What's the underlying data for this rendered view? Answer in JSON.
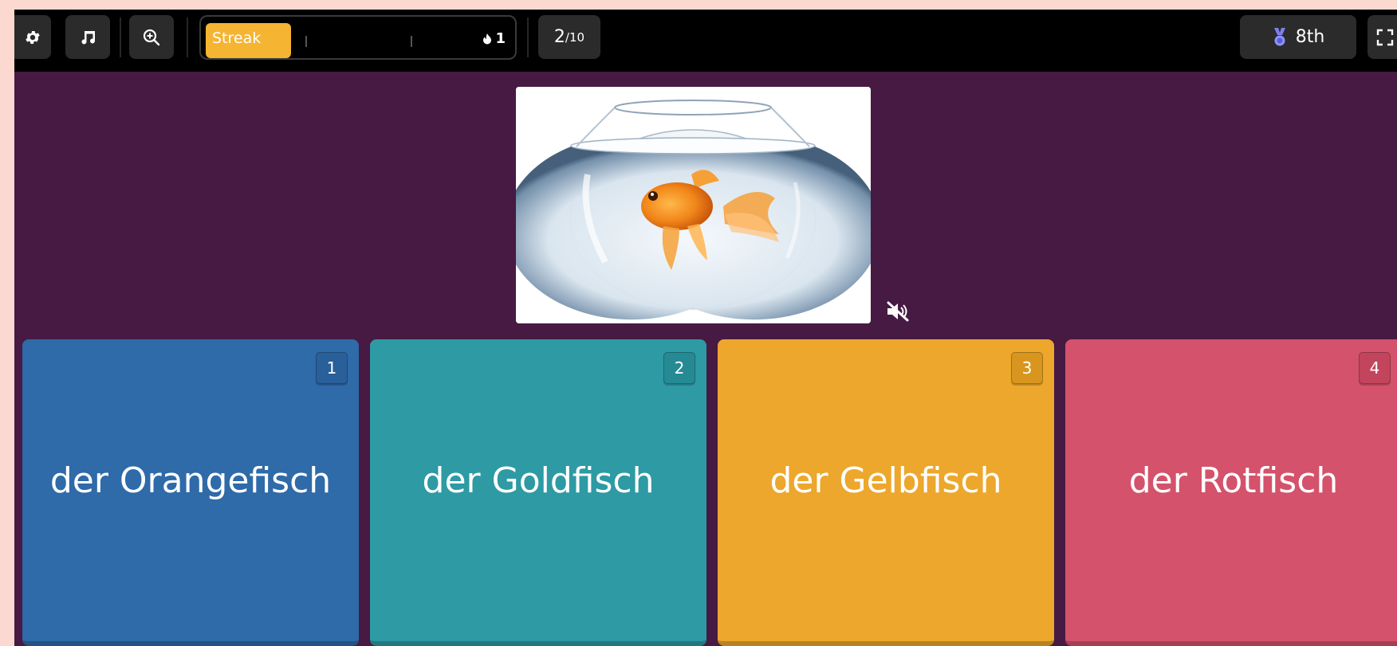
{
  "toolbar": {
    "settings_icon": "gear-icon",
    "music_icon": "music-note-icon",
    "zoom_icon": "zoom-in-icon",
    "streak_label": "Streak",
    "streak_count": "1",
    "streak_fill_fraction": 0.28,
    "progress_current": "2",
    "progress_total": "/10",
    "rank": "8th",
    "rank_icon": "medal-icon",
    "fullscreen_icon": "fullscreen-icon"
  },
  "question": {
    "image": "goldfish-in-bowl",
    "mute_icon": "volume-mute-icon"
  },
  "options": [
    {
      "number": "1",
      "text": "der Orangefisch",
      "color": "#2f6aa9",
      "badge": "#29609a"
    },
    {
      "number": "2",
      "text": "der Goldfisch",
      "color": "#2d9aa4",
      "badge": "#258a94"
    },
    {
      "number": "3",
      "text": "der Gelbfisch",
      "color": "#eca72c",
      "badge": "#d9961f"
    },
    {
      "number": "4",
      "text": "der Rotfisch",
      "color": "#d4526b",
      "badge": "#c3445d"
    }
  ]
}
